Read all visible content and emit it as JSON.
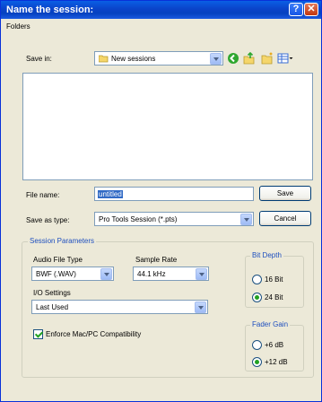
{
  "window": {
    "title": "Name the session:",
    "help_glyph": "?",
    "close_glyph": "✕"
  },
  "folders_label": "Folders",
  "save_in": {
    "label": "Save in:",
    "value": "New sessions"
  },
  "toolbar_icons": [
    "back-icon",
    "up-folder-icon",
    "new-folder-icon",
    "view-menu-icon"
  ],
  "file_name": {
    "label": "File name:",
    "value": "untitled"
  },
  "save_as_type": {
    "label": "Save as type:",
    "value": "Pro Tools Session (*.pts)"
  },
  "buttons": {
    "save": "Save",
    "cancel": "Cancel"
  },
  "session_parameters": {
    "title": "Session Parameters",
    "audio_file_type": {
      "label": "Audio File Type",
      "value": "BWF (.WAV)"
    },
    "sample_rate": {
      "label": "Sample Rate",
      "value": "44.1 kHz"
    },
    "io_settings": {
      "label": "I/O Settings",
      "value": "Last Used"
    },
    "enforce": {
      "label": "Enforce Mac/PC Compatibility",
      "checked": true
    },
    "bit_depth": {
      "title": "Bit Depth",
      "options": [
        "16 Bit",
        "24 Bit"
      ],
      "selected": "24 Bit"
    },
    "fader_gain": {
      "title": "Fader Gain",
      "options": [
        "+6 dB",
        "+12 dB"
      ],
      "selected": "+12 dB"
    }
  },
  "colors": {
    "title_bar": "#0a43c9",
    "face": "#ece9d8",
    "group_title": "#1e4fbf"
  }
}
